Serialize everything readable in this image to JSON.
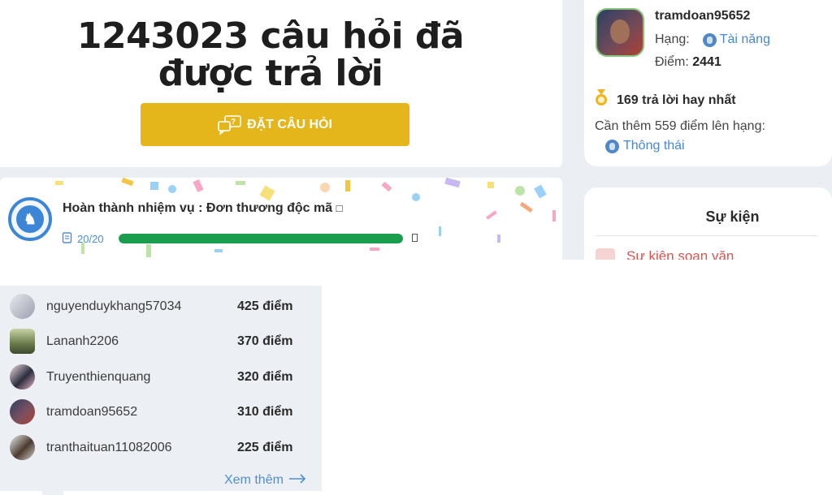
{
  "hero": {
    "title_line1": "1243023 câu hỏi đã",
    "title_line2": "được trả lời",
    "ask_button": "ĐẶT CÂU HỎI"
  },
  "mission": {
    "title": "Hoàn thành nhiệm vụ : Đơn thương độc mã",
    "title_suffix": "□",
    "progress_text": "20/20",
    "progress_fraction": 1.0,
    "progress_color": "#1a9e4e",
    "badge_icon": "knight-chess-icon"
  },
  "profile": {
    "username": "tramdoan95652",
    "rank_label": "Hạng:",
    "rank_value": "Tài năng",
    "points_label": "Điểm:",
    "points_value": "2441",
    "best_answers": "169 trả lời hay nhất",
    "need_text": "Cần thêm 559 điểm lên hạng:",
    "next_rank": "Thông thái"
  },
  "events": {
    "title": "Sự kiện",
    "items": [
      "Sự kiện soạn văn"
    ]
  },
  "leaderboard": {
    "rows": [
      {
        "name": "nguyenduykhang57034",
        "score": "425 điểm"
      },
      {
        "name": "Lananh2206",
        "score": "370 điểm"
      },
      {
        "name": "Truyenthienquang",
        "score": "320 điểm"
      },
      {
        "name": "tramdoan95652",
        "score": "310 điểm"
      },
      {
        "name": "tranthaituan11082006",
        "score": "225 điểm"
      }
    ],
    "see_more": "Xem thêm"
  },
  "colors": {
    "accent_button": "#e5b61b",
    "link_blue": "#4788d1",
    "event_red": "#d9534f"
  }
}
